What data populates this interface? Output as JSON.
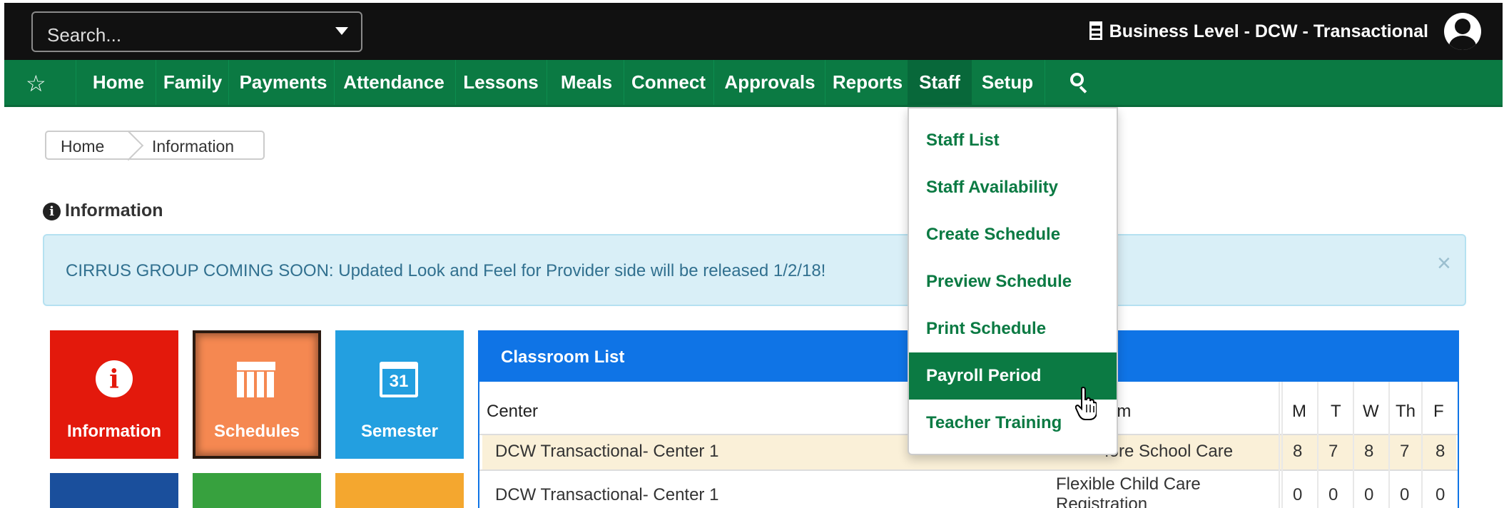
{
  "topbar": {
    "search_placeholder": "Search...",
    "business_label": "Business Level - DCW - Transactional"
  },
  "navbar": {
    "items": [
      "Home",
      "Family",
      "Payments",
      "Attendance",
      "Lessons",
      "Meals",
      "Connect",
      "Approvals",
      "Reports",
      "Staff",
      "Setup"
    ],
    "active": "Staff"
  },
  "breadcrumb": {
    "home": "Home",
    "current": "Information"
  },
  "page": {
    "section_title": "Information",
    "alert_text": "CIRRUS GROUP COMING SOON: Updated Look and Feel for Provider side will be released 1/2/18!",
    "alert_close": "×"
  },
  "tiles": {
    "information": "Information",
    "schedules": "Schedules",
    "semester": "Semester",
    "semester_icon_day": "31"
  },
  "classroom": {
    "title": "Classroom List",
    "headers": {
      "center": "Center",
      "classroom": "om",
      "days": [
        "M",
        "T",
        "W",
        "Th",
        "F"
      ]
    },
    "rows": [
      {
        "center": "DCW Transactional- Center 1",
        "classroom": "Before School Care",
        "classroom_visible": "fore School Care",
        "days": [
          "8",
          "7",
          "8",
          "7",
          "8"
        ]
      },
      {
        "center": "DCW Transactional- Center 1",
        "classroom_line1": "Flexible Child Care",
        "classroom_line2": "Registration",
        "days": [
          "0",
          "0",
          "0",
          "0",
          "0"
        ]
      }
    ]
  },
  "staff_menu": {
    "items": [
      "Staff List",
      "Staff Availability",
      "Create Schedule",
      "Preview Schedule",
      "Print Schedule",
      "Payroll Period",
      "Teacher Training"
    ],
    "hovered": "Payroll Period"
  },
  "colors": {
    "nav_green": "#0b7a43",
    "alert_bg": "#d9eff7",
    "panel_blue": "#0f74e6",
    "info_red": "#e3190c",
    "schedule_orange": "#f58851",
    "semester_blue": "#239fe0"
  },
  "icons": [
    "star-icon",
    "search-icon",
    "building-icon",
    "user-avatar-icon",
    "info-icon",
    "calendar-icon",
    "close-icon",
    "hand-pointer-icon"
  ]
}
